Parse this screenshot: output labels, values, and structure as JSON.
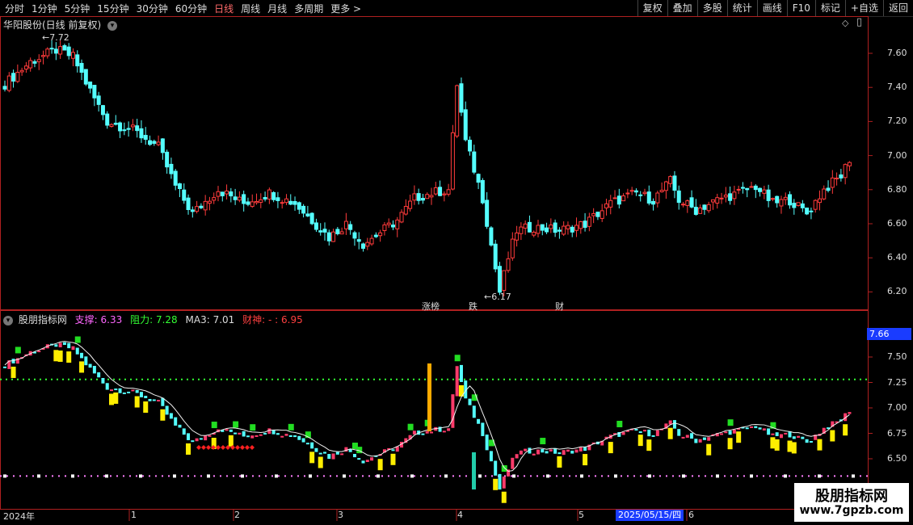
{
  "toolbar": {
    "periods": [
      "分时",
      "1分钟",
      "5分钟",
      "15分钟",
      "30分钟",
      "60分钟",
      "日线",
      "周线",
      "月线",
      "多周期",
      "更多 >"
    ],
    "active_index": 6,
    "right_buttons": [
      "复权",
      "叠加",
      "多股",
      "统计",
      "画线",
      "F10",
      "标记",
      "+自选",
      "返回"
    ]
  },
  "main_panel": {
    "title": "华阳股份(日线 前复权)",
    "y_ticks": [
      "7.60",
      "7.40",
      "7.20",
      "7.00",
      "6.80",
      "6.60",
      "6.40",
      "6.20"
    ],
    "high_label": "7.72",
    "low_label": "←6.17",
    "badges": [
      {
        "text": "涨榜",
        "color": "#ff5050"
      },
      {
        "text": "跌",
        "color": "#33ff33"
      },
      {
        "text": "财",
        "color": "#5aa0ff"
      }
    ]
  },
  "indicator_panel": {
    "title": "股朋指标网",
    "support_label": "支撑:",
    "support_value": "6.33",
    "resist_label": "阻力:",
    "resist_value": "7.28",
    "ma_label": "MA3:",
    "ma_value": "7.01",
    "wealth_label": "财神:",
    "wealth_value": "- : 6.95",
    "price_box": "7.66",
    "y_ticks": [
      "7.50",
      "7.25",
      "7.00",
      "6.75",
      "6.50"
    ]
  },
  "date_axis": {
    "labels": [
      "2024年",
      "1",
      "2",
      "3",
      "4",
      "5",
      "6"
    ],
    "cursor_date": "2025/05/15/四"
  },
  "logo": {
    "line1": "股朋指标网",
    "line2": "www.7gpzb.com"
  },
  "colors": {
    "up": "#ff3b3b",
    "down": "#54ffff",
    "border": "#b02020",
    "support": "#ff80ff",
    "resist": "#33ff33"
  }
}
